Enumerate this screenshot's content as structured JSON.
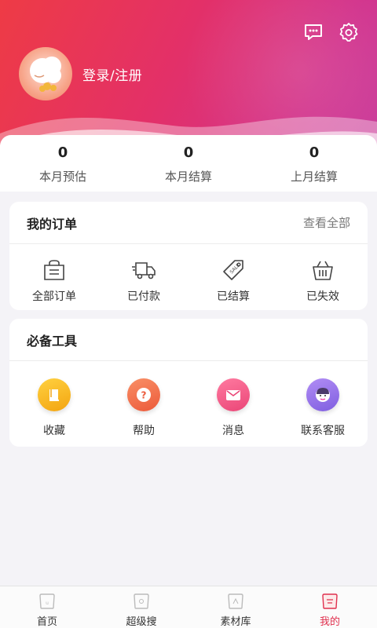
{
  "header": {
    "login_label": "登录/注册",
    "icons": {
      "message": "message-icon",
      "settings": "gear-icon"
    }
  },
  "stats": [
    {
      "value": "0",
      "label": "本月预估"
    },
    {
      "value": "0",
      "label": "本月结算"
    },
    {
      "value": "0",
      "label": "上月结算"
    }
  ],
  "orders": {
    "title": "我的订单",
    "more": "查看全部",
    "items": [
      {
        "label": "全部订单",
        "icon": "bag-icon"
      },
      {
        "label": "已付款",
        "icon": "truck-icon"
      },
      {
        "label": "已结算",
        "icon": "sale-tag-icon"
      },
      {
        "label": "已失效",
        "icon": "basket-icon"
      }
    ]
  },
  "tools": {
    "title": "必备工具",
    "items": [
      {
        "label": "收藏",
        "icon": "favorite-book-icon",
        "color": "#f5b51b"
      },
      {
        "label": "帮助",
        "icon": "help-icon",
        "color": "#f2744d"
      },
      {
        "label": "消息",
        "icon": "mail-icon",
        "color": "#ef5b88"
      },
      {
        "label": "联系客服",
        "icon": "customer-service-icon",
        "color": "#9b6fe8"
      }
    ]
  },
  "tabbar": [
    {
      "label": "首页",
      "icon": "home-tab-icon",
      "active": false
    },
    {
      "label": "超级搜",
      "icon": "search-tab-icon",
      "active": false
    },
    {
      "label": "素材库",
      "icon": "library-tab-icon",
      "active": false
    },
    {
      "label": "我的",
      "icon": "mine-tab-icon",
      "active": true
    }
  ],
  "colors": {
    "header_start": "#ee3b45",
    "header_end": "#c93a9a",
    "active_tab": "#e0304e"
  }
}
